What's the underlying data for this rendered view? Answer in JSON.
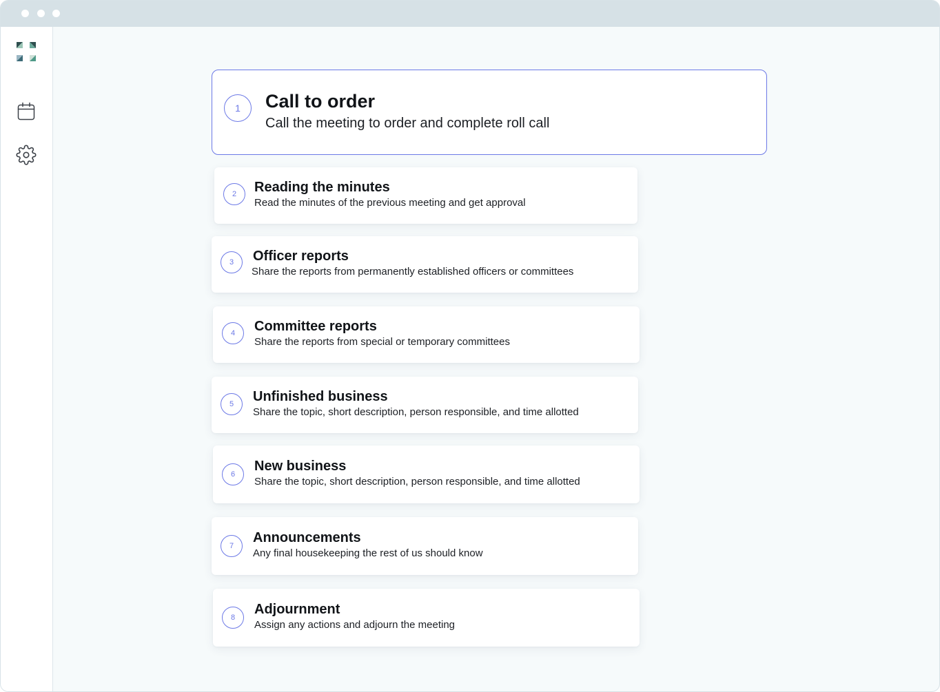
{
  "window": {
    "controls": [
      "close",
      "minimize",
      "maximize"
    ]
  },
  "sidebar": {
    "logo": "app-logo",
    "items": [
      {
        "name": "calendar",
        "icon": "calendar-icon"
      },
      {
        "name": "settings",
        "icon": "gear-icon"
      }
    ]
  },
  "agenda": {
    "items": [
      {
        "number": "1",
        "title": "Call to order",
        "description": "Call the meeting to order and complete roll call"
      },
      {
        "number": "2",
        "title": "Reading the minutes",
        "description": "Read the minutes of the previous meeting and get approval"
      },
      {
        "number": "3",
        "title": "Officer reports",
        "description": "Share the reports from permanently established officers or committees"
      },
      {
        "number": "4",
        "title": "Committee reports",
        "description": "Share the reports from special or temporary committees"
      },
      {
        "number": "5",
        "title": "Unfinished business",
        "description": "Share the topic, short description, person responsible, and time allotted"
      },
      {
        "number": "6",
        "title": "New business",
        "description": "Share the topic, short description, person responsible, and time allotted"
      },
      {
        "number": "7",
        "title": "Announcements",
        "description": "Any final housekeeping the rest of us should know"
      },
      {
        "number": "8",
        "title": "Adjournment",
        "description": "Assign any actions and adjourn the meeting"
      }
    ]
  },
  "colors": {
    "accent": "#6b78e6",
    "background": "#f6fafb",
    "titlebar": "#d6e1e6"
  }
}
